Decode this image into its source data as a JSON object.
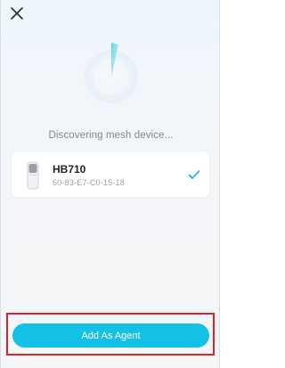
{
  "status_text": "Discovering mesh device...",
  "device": {
    "name": "HB710",
    "mac": "60-83-E7-C0-15-18",
    "selected": true
  },
  "primary_action": {
    "label": "Add As Agent"
  },
  "icons": {
    "close": "close-icon",
    "radar": "radar-scan-icon",
    "device": "mesh-device-icon",
    "check": "checkmark-icon"
  },
  "colors": {
    "accent": "#12c1e3",
    "highlight_border": "#e0212b",
    "check": "#1aa7e0"
  }
}
